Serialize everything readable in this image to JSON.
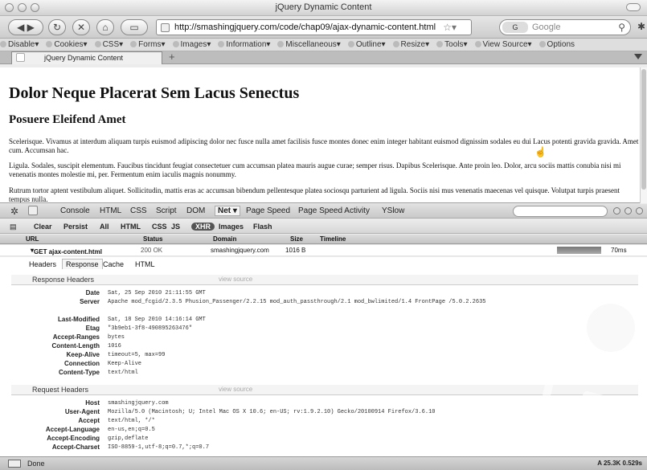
{
  "window": {
    "title": "jQuery Dynamic Content"
  },
  "nav": {
    "url": "http://smashingjquery.com/code/chap09/ajax-dynamic-content.html",
    "search_engine": "G",
    "search_placeholder": "Google"
  },
  "devbar": {
    "items": [
      {
        "label": "Disable",
        "icon": "no-entry-icon"
      },
      {
        "label": "Cookies",
        "icon": "cookie-icon"
      },
      {
        "label": "CSS",
        "icon": "css-icon"
      },
      {
        "label": "Forms",
        "icon": "form-icon"
      },
      {
        "label": "Images",
        "icon": "image-icon"
      },
      {
        "label": "Information",
        "icon": "info-icon"
      },
      {
        "label": "Miscellaneous",
        "icon": "misc-icon"
      },
      {
        "label": "Outline",
        "icon": "pencil-icon"
      },
      {
        "label": "Resize",
        "icon": "resize-icon"
      },
      {
        "label": "Tools",
        "icon": "wrench-icon"
      },
      {
        "label": "View Source",
        "icon": "source-icon"
      },
      {
        "label": "Options",
        "icon": "gear-icon"
      }
    ]
  },
  "tabs": [
    {
      "label": "jQuery Dynamic Content"
    }
  ],
  "page": {
    "h1": "Dolor Neque Placerat Sem Lacus Senectus",
    "h2": "Posuere Eleifend Amet",
    "p1": "Scelerisque. Vivamus at interdum aliquam turpis euismod adipiscing dolor nec fusce nulla amet facilisis fusce montes donec enim integer habitant euismod dignissim sodales eu dui Lacus potenti gravida gravida. Amet cum. Accumsan hac.",
    "p2": "Ligula. Sodales, suscipit elementum. Faucibus tincidunt feugiat consectetuer cum accumsan platea mauris augue curae; semper risus. Dapibus Scelerisque. Ante proin leo. Dolor, arcu sociis mattis conubia nisi mi venenatis montes molestie mi, per. Fermentum enim iaculis magnis nonummy.",
    "p3": "Rutrum tortor aptent vestibulum aliquet. Sollicitudin, mattis eras ac accumsan bibendum pellentesque platea sociosqu parturient ad ligula. Sociis nisi mus venenatis maecenas vel quisque. Volutpat turpis praesent tempus nulla."
  },
  "firebug": {
    "tabs": [
      "Console",
      "HTML",
      "CSS",
      "Script",
      "DOM",
      "Net ▾",
      "Page Speed",
      "Page Speed Activity",
      "YSlow"
    ],
    "filters": [
      "Clear",
      "Persist",
      "All",
      "HTML",
      "CSS",
      "JS",
      "XHR",
      "Images",
      "Flash"
    ],
    "columns": [
      "URL",
      "Status",
      "Domain",
      "Size",
      "Timeline"
    ],
    "request": {
      "method_url": "GET ajax-content.html",
      "status": "200 OK",
      "domain": "smashingjquery.com",
      "size": "1016 B",
      "time": "70ms",
      "timeline_fraction": 0.55
    },
    "detail_tabs": [
      "Headers",
      "Response",
      "Cache",
      "HTML"
    ],
    "response_headers_title": "Response Headers",
    "response_hint": "view source",
    "response_headers": [
      {
        "name": "Date",
        "value": "Sat, 25 Sep 2010 21:11:55 GMT"
      },
      {
        "name": "Server",
        "value": "Apache mod_fcgid/2.3.5 Phusion_Passenger/2.2.15 mod_auth_passthrough/2.1 mod_bwlimited/1.4 FrontPage /5.0.2.2635"
      },
      {
        "name": "Last-Modified",
        "value": "Sat, 18 Sep 2010 14:16:14 GMT"
      },
      {
        "name": "Etag",
        "value": "\"3b9eb1-3f8-490895263476\""
      },
      {
        "name": "Accept-Ranges",
        "value": "bytes"
      },
      {
        "name": "Content-Length",
        "value": "1016"
      },
      {
        "name": "Keep-Alive",
        "value": "timeout=5, max=99"
      },
      {
        "name": "Connection",
        "value": "Keep-Alive"
      },
      {
        "name": "Content-Type",
        "value": "text/html"
      }
    ],
    "request_headers_title": "Request Headers",
    "request_hint": "view source",
    "request_headers": [
      {
        "name": "Host",
        "value": "smashingjquery.com"
      },
      {
        "name": "User-Agent",
        "value": "Mozilla/5.0 (Macintosh; U; Intel Mac OS X 10.6; en-US; rv:1.9.2.10) Gecko/20100914 Firefox/3.6.10"
      },
      {
        "name": "Accept",
        "value": "text/html, */*"
      },
      {
        "name": "Accept-Language",
        "value": "en-us,en;q=0.5"
      },
      {
        "name": "Accept-Encoding",
        "value": "gzip,deflate"
      },
      {
        "name": "Accept-Charset",
        "value": "ISO-8859-1,utf-8;q=0.7,*;q=0.7"
      }
    ]
  },
  "status": {
    "text": "Done",
    "right": "A  25.3K  0.529s"
  }
}
